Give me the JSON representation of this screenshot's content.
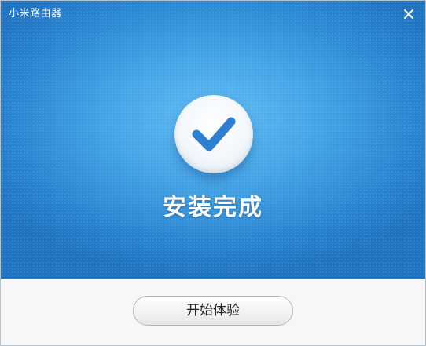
{
  "window": {
    "title": "小米路由器",
    "close_icon": "close-icon"
  },
  "main": {
    "status_icon": "checkmark-icon",
    "status_text": "安装完成",
    "accent_color": "#3aa0e6",
    "check_color": "#2f7fd0"
  },
  "footer": {
    "start_button_label": "开始体验"
  }
}
